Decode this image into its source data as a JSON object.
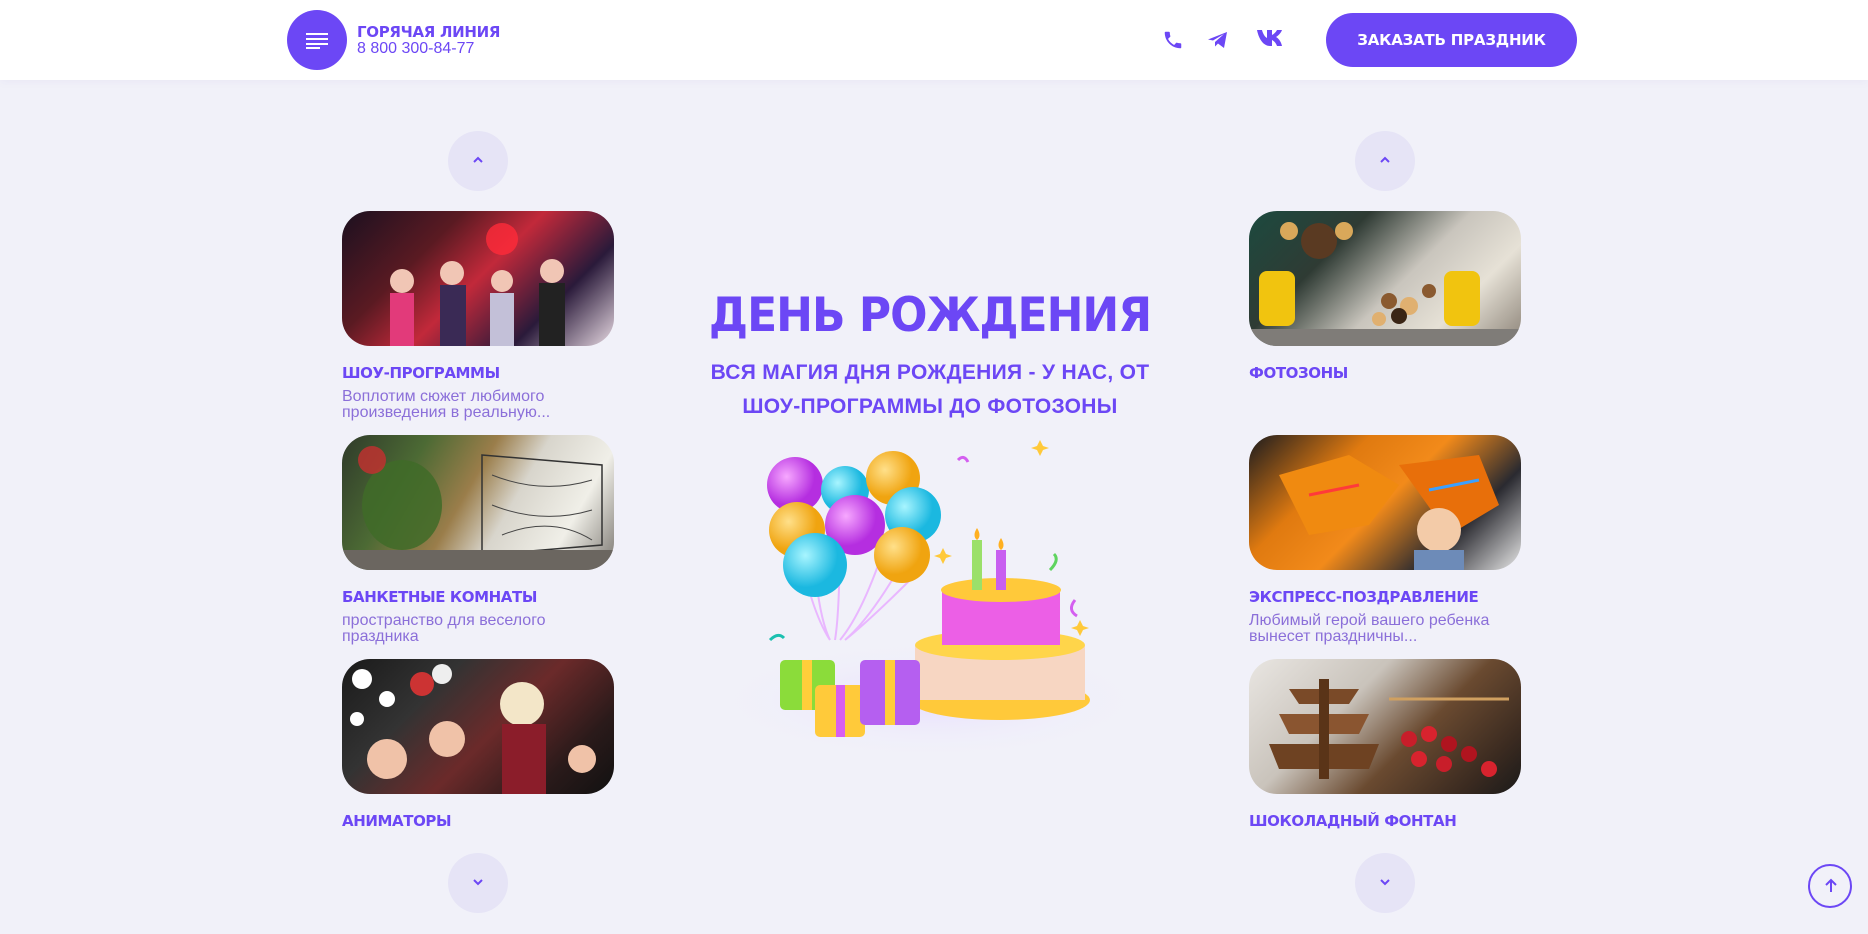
{
  "header": {
    "hotline_title": "ГОРЯЧАЯ ЛИНИЯ",
    "hotline_phone": "8 800 300-84-77",
    "order_button": "ЗАКАЗАТЬ ПРАЗДНИК",
    "social_icons": [
      "phone-icon",
      "telegram-icon",
      "vk-icon"
    ]
  },
  "main": {
    "title": "ДЕНЬ РОЖДЕНИЯ",
    "subtitle": "ВСЯ МАГИЯ ДНЯ РОЖДЕНИЯ - У НАС, ОТ ШОУ-ПРОГРАММЫ ДО ФОТОЗОНЫ"
  },
  "left_services": [
    {
      "title": "ШОУ-ПРОГРАММЫ",
      "desc": "Воплотим сюжет любимого произведения в реальную..."
    },
    {
      "title": "БАНКЕТНЫЕ КОМНАТЫ",
      "desc": "пространство для веселого праздника"
    },
    {
      "title": "АНИМАТОРЫ",
      "desc": ""
    }
  ],
  "right_services": [
    {
      "title": "ФОТОЗОНЫ",
      "desc": ""
    },
    {
      "title": "ЭКСПРЕСС-ПОЗДРАВЛЕНИЕ",
      "desc": "Любимый герой вашего ребенка вынесет праздничны..."
    },
    {
      "title": "ШОКОЛАДНЫЙ ФОНТАН",
      "desc": ""
    }
  ],
  "colors": {
    "accent": "#6c47f5",
    "background": "#f1f1f9",
    "arrow_bg": "#e6e4f6",
    "desc_text": "#8b6fd9"
  }
}
